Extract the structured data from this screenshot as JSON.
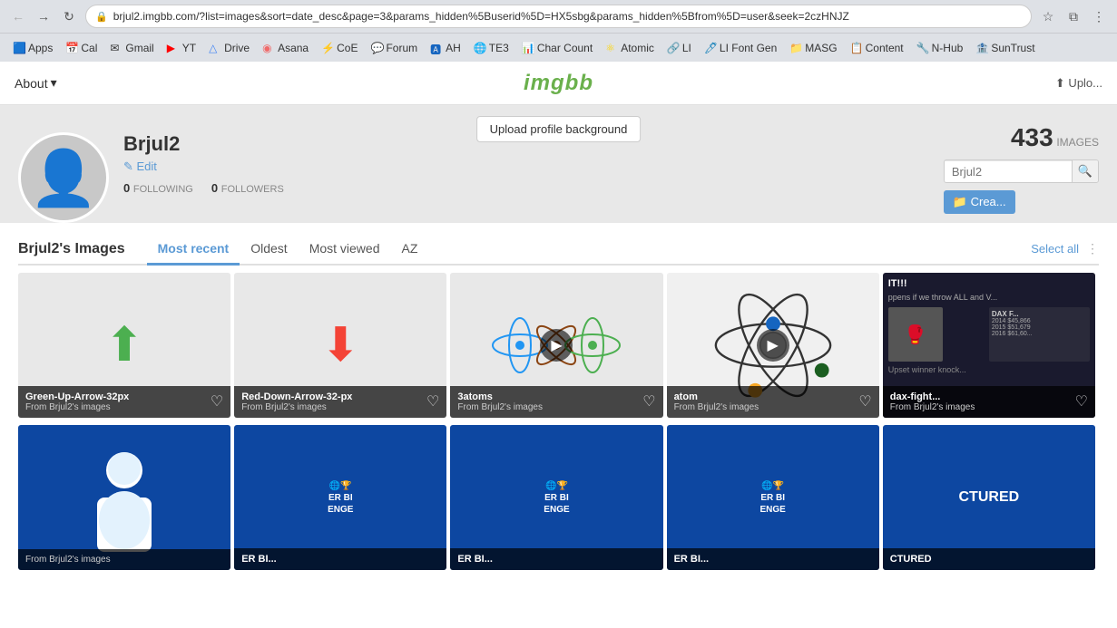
{
  "browser": {
    "url": "brjul2.imgbb.com/?list=images&sort=date_desc&page=3&params_hidden%5Buserid%5D=HX5sbg&params_hidden%5Bfrom%5D=user&seek=2czHNJZ",
    "back_btn": "←",
    "forward_btn": "→",
    "reload_btn": "↻",
    "home_btn": "⌂"
  },
  "bookmarks": [
    {
      "label": "Apps",
      "icon": "🟦"
    },
    {
      "label": "Cal",
      "icon": "📅"
    },
    {
      "label": "Gmail",
      "icon": "✉"
    },
    {
      "label": "YT",
      "icon": "▶"
    },
    {
      "label": "Drive",
      "icon": "△"
    },
    {
      "label": "Asana",
      "icon": "◉"
    },
    {
      "label": "CoE",
      "icon": "⚡"
    },
    {
      "label": "Forum",
      "icon": "💬"
    },
    {
      "label": "AH",
      "icon": "🅰"
    },
    {
      "label": "TE3",
      "icon": "🌐"
    },
    {
      "label": "Char Count",
      "icon": "📊"
    },
    {
      "label": "Atomic",
      "icon": "⚛"
    },
    {
      "label": "LI",
      "icon": "🔗"
    },
    {
      "label": "LI Font Gen",
      "icon": "🖊"
    },
    {
      "label": "MASG",
      "icon": "📁"
    },
    {
      "label": "Content",
      "icon": "📋"
    },
    {
      "label": "N-Hub",
      "icon": "🔧"
    },
    {
      "label": "SunTrust",
      "icon": "🏦"
    }
  ],
  "top_nav": {
    "about_label": "About",
    "about_arrow": "▾",
    "site_title": "imgbb",
    "upload_label": "⬆ Uplo..."
  },
  "profile": {
    "upload_bg_label": "Upload profile background",
    "name": "Brjul2",
    "edit_label": "✎ Edit",
    "following_count": "0",
    "following_label": "FOLLOWING",
    "followers_count": "0",
    "followers_label": "FOLLOWERS",
    "images_count": "433",
    "images_label": "IMAGES",
    "search_placeholder": "Brjul2",
    "create_album_label": "📁 Crea..."
  },
  "images_section": {
    "section_title": "Brjul2's Images",
    "tabs": [
      {
        "label": "Most recent",
        "active": true
      },
      {
        "label": "Oldest",
        "active": false
      },
      {
        "label": "Most viewed",
        "active": false
      },
      {
        "label": "AZ",
        "active": false
      }
    ],
    "select_all_label": "Select all"
  },
  "images_row1": [
    {
      "name": "Green-Up-Arrow-32px",
      "source": "From Brjul2's images",
      "type": "arrow-up",
      "bg": "light"
    },
    {
      "name": "Red-Down-Arrow-32-px",
      "source": "From Brjul2's images",
      "type": "arrow-down",
      "bg": "light"
    },
    {
      "name": "3atoms",
      "source": "From Brjul2's images",
      "type": "atoms",
      "bg": "light",
      "has_play": true
    },
    {
      "name": "atom",
      "source": "From Brjul2's images",
      "type": "atom-single",
      "bg": "light",
      "has_play": true
    },
    {
      "name": "dax-fight...",
      "source": "From Brjul2's images",
      "type": "dax",
      "bg": "dark"
    }
  ],
  "images_row2": [
    {
      "name": "",
      "source": "From Brjul2's images",
      "type": "person-blue",
      "bg": "blue"
    },
    {
      "name": "ER BI...",
      "source": "",
      "type": "bi-challenge",
      "bg": "blue",
      "text": "ER BI ENGE"
    },
    {
      "name": "ER BI...",
      "source": "",
      "type": "bi-challenge",
      "bg": "blue",
      "text": "ER BI ENGE"
    },
    {
      "name": "ER BI...",
      "source": "",
      "type": "bi-challenge",
      "bg": "blue",
      "text": "ER BI ENGE"
    },
    {
      "name": "CTURED",
      "source": "",
      "type": "bi-challenge2",
      "bg": "blue",
      "text": "CTURED"
    }
  ]
}
